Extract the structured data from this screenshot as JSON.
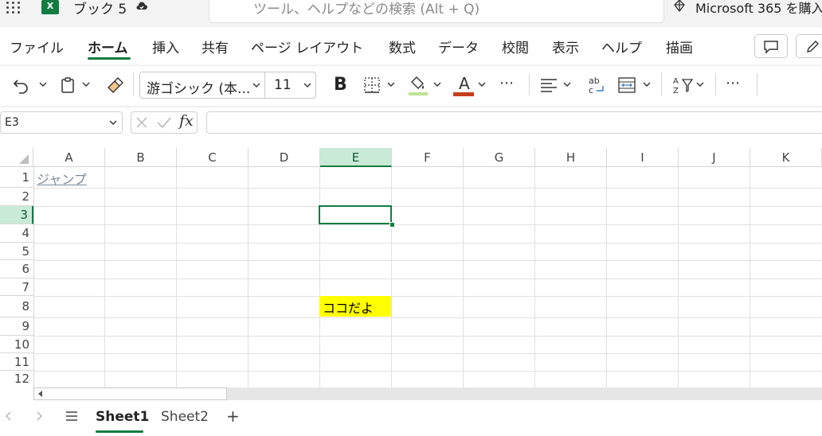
{
  "titlebar": {
    "app_logo": "X",
    "document_title": "ブック 5",
    "search_placeholder": "ツール、ヘルプなどの検索 (Alt + Q)",
    "m365_text": "Microsoft 365 を購入"
  },
  "tabs": [
    {
      "label": "ファイル"
    },
    {
      "label": "ホーム",
      "selected": true
    },
    {
      "label": "挿入"
    },
    {
      "label": "共有"
    },
    {
      "label": "ページ レイアウト"
    },
    {
      "label": "数式"
    },
    {
      "label": "データ"
    },
    {
      "label": "校閲"
    },
    {
      "label": "表示"
    },
    {
      "label": "ヘルプ"
    },
    {
      "label": "描画"
    }
  ],
  "ribbon": {
    "font_name": "游ゴシック (本...",
    "font_size": "11",
    "bold_label": "B",
    "font_color_label": "A",
    "more_label": "⋯",
    "fill_color": "#92d050",
    "font_color": "#c43e1c"
  },
  "formula_bar": {
    "name_box": "E3",
    "fx_label": "fx",
    "formula": ""
  },
  "grid": {
    "columns": [
      "A",
      "B",
      "C",
      "D",
      "E",
      "F",
      "G",
      "H",
      "I",
      "J",
      "K"
    ],
    "rows": [
      "1",
      "2",
      "3",
      "4",
      "5",
      "6",
      "7",
      "8",
      "9",
      "10",
      "11",
      "12"
    ],
    "selected_column": "E",
    "selected_row": "3",
    "cells": {
      "A1": "ジャンプ",
      "E8": "ココだよ"
    },
    "highlight_color": "#ffff00",
    "accent_color": "#107c41"
  },
  "sheets": {
    "tabs": [
      "Sheet1",
      "Sheet2"
    ],
    "active": "Sheet1",
    "add_label": "+"
  }
}
